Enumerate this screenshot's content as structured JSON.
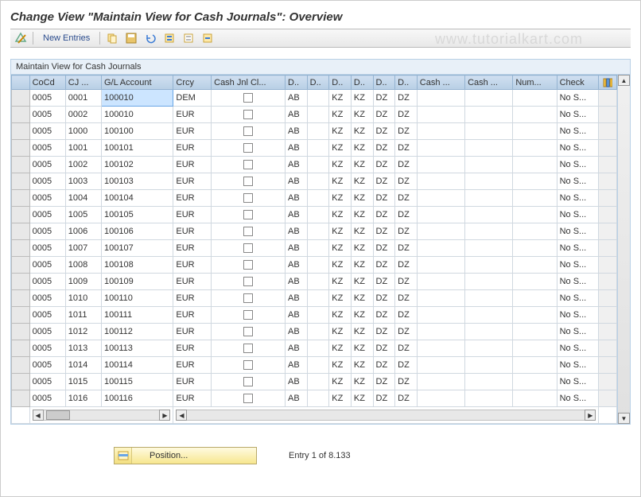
{
  "title": "Change View \"Maintain View for Cash Journals\": Overview",
  "toolbar": {
    "new_entries": "New Entries"
  },
  "watermark": "www.tutorialkart.com",
  "panel_title": "Maintain View for Cash Journals",
  "headers": {
    "sel": "",
    "cocd": "CoCd",
    "cj": "CJ ...",
    "gl": "G/L Account",
    "crcy": "Crcy",
    "cjcl": "Cash Jnl Cl...",
    "d1": "D..",
    "d2": "D..",
    "d3": "D..",
    "d4": "D..",
    "d5": "D..",
    "d6": "D..",
    "cash1": "Cash ...",
    "cash2": "Cash ...",
    "num": "Num...",
    "check": "Check"
  },
  "rows_visible": 17,
  "rows": [
    {
      "cocd": "0005",
      "cj": "0001",
      "gl": "100010",
      "crcy": "DEM",
      "d1": "AB",
      "d2": "",
      "d3": "KZ",
      "d4": "KZ",
      "d5": "DZ",
      "d6": "DZ",
      "check": "No S..."
    },
    {
      "cocd": "0005",
      "cj": "0002",
      "gl": "100010",
      "crcy": "EUR",
      "d1": "AB",
      "d2": "",
      "d3": "KZ",
      "d4": "KZ",
      "d5": "DZ",
      "d6": "DZ",
      "check": "No S..."
    },
    {
      "cocd": "0005",
      "cj": "1000",
      "gl": "100100",
      "crcy": "EUR",
      "d1": "AB",
      "d2": "",
      "d3": "KZ",
      "d4": "KZ",
      "d5": "DZ",
      "d6": "DZ",
      "check": "No S..."
    },
    {
      "cocd": "0005",
      "cj": "1001",
      "gl": "100101",
      "crcy": "EUR",
      "d1": "AB",
      "d2": "",
      "d3": "KZ",
      "d4": "KZ",
      "d5": "DZ",
      "d6": "DZ",
      "check": "No S..."
    },
    {
      "cocd": "0005",
      "cj": "1002",
      "gl": "100102",
      "crcy": "EUR",
      "d1": "AB",
      "d2": "",
      "d3": "KZ",
      "d4": "KZ",
      "d5": "DZ",
      "d6": "DZ",
      "check": "No S..."
    },
    {
      "cocd": "0005",
      "cj": "1003",
      "gl": "100103",
      "crcy": "EUR",
      "d1": "AB",
      "d2": "",
      "d3": "KZ",
      "d4": "KZ",
      "d5": "DZ",
      "d6": "DZ",
      "check": "No S..."
    },
    {
      "cocd": "0005",
      "cj": "1004",
      "gl": "100104",
      "crcy": "EUR",
      "d1": "AB",
      "d2": "",
      "d3": "KZ",
      "d4": "KZ",
      "d5": "DZ",
      "d6": "DZ",
      "check": "No S..."
    },
    {
      "cocd": "0005",
      "cj": "1005",
      "gl": "100105",
      "crcy": "EUR",
      "d1": "AB",
      "d2": "",
      "d3": "KZ",
      "d4": "KZ",
      "d5": "DZ",
      "d6": "DZ",
      "check": "No S..."
    },
    {
      "cocd": "0005",
      "cj": "1006",
      "gl": "100106",
      "crcy": "EUR",
      "d1": "AB",
      "d2": "",
      "d3": "KZ",
      "d4": "KZ",
      "d5": "DZ",
      "d6": "DZ",
      "check": "No S..."
    },
    {
      "cocd": "0005",
      "cj": "1007",
      "gl": "100107",
      "crcy": "EUR",
      "d1": "AB",
      "d2": "",
      "d3": "KZ",
      "d4": "KZ",
      "d5": "DZ",
      "d6": "DZ",
      "check": "No S..."
    },
    {
      "cocd": "0005",
      "cj": "1008",
      "gl": "100108",
      "crcy": "EUR",
      "d1": "AB",
      "d2": "",
      "d3": "KZ",
      "d4": "KZ",
      "d5": "DZ",
      "d6": "DZ",
      "check": "No S..."
    },
    {
      "cocd": "0005",
      "cj": "1009",
      "gl": "100109",
      "crcy": "EUR",
      "d1": "AB",
      "d2": "",
      "d3": "KZ",
      "d4": "KZ",
      "d5": "DZ",
      "d6": "DZ",
      "check": "No S..."
    },
    {
      "cocd": "0005",
      "cj": "1010",
      "gl": "100110",
      "crcy": "EUR",
      "d1": "AB",
      "d2": "",
      "d3": "KZ",
      "d4": "KZ",
      "d5": "DZ",
      "d6": "DZ",
      "check": "No S..."
    },
    {
      "cocd": "0005",
      "cj": "1011",
      "gl": "100111",
      "crcy": "EUR",
      "d1": "AB",
      "d2": "",
      "d3": "KZ",
      "d4": "KZ",
      "d5": "DZ",
      "d6": "DZ",
      "check": "No S..."
    },
    {
      "cocd": "0005",
      "cj": "1012",
      "gl": "100112",
      "crcy": "EUR",
      "d1": "AB",
      "d2": "",
      "d3": "KZ",
      "d4": "KZ",
      "d5": "DZ",
      "d6": "DZ",
      "check": "No S..."
    },
    {
      "cocd": "0005",
      "cj": "1013",
      "gl": "100113",
      "crcy": "EUR",
      "d1": "AB",
      "d2": "",
      "d3": "KZ",
      "d4": "KZ",
      "d5": "DZ",
      "d6": "DZ",
      "check": "No S..."
    },
    {
      "cocd": "0005",
      "cj": "1014",
      "gl": "100114",
      "crcy": "EUR",
      "d1": "AB",
      "d2": "",
      "d3": "KZ",
      "d4": "KZ",
      "d5": "DZ",
      "d6": "DZ",
      "check": "No S..."
    },
    {
      "cocd": "0005",
      "cj": "1015",
      "gl": "100115",
      "crcy": "EUR",
      "d1": "AB",
      "d2": "",
      "d3": "KZ",
      "d4": "KZ",
      "d5": "DZ",
      "d6": "DZ",
      "check": "No S..."
    },
    {
      "cocd": "0005",
      "cj": "1016",
      "gl": "100116",
      "crcy": "EUR",
      "d1": "AB",
      "d2": "",
      "d3": "KZ",
      "d4": "KZ",
      "d5": "DZ",
      "d6": "DZ",
      "check": "No S..."
    }
  ],
  "selected_cell": {
    "row": 0,
    "col": "gl"
  },
  "footer": {
    "position_label": "Position...",
    "entry_text": "Entry 1 of 8.133"
  }
}
